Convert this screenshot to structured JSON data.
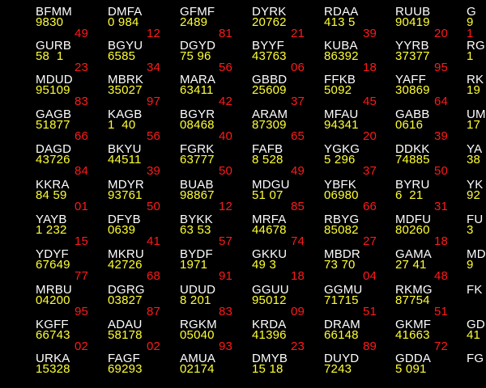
{
  "colors": {
    "background": "#000000",
    "symbol": "#ffffff",
    "value": "#ffff33",
    "change": "#ff1a1a"
  },
  "board": {
    "rows": [
      [
        {
          "symbol": "BFMM",
          "value": "9830",
          "change": "49"
        },
        {
          "symbol": "DMFA",
          "value": "0 984",
          "change": "12"
        },
        {
          "symbol": "GFMF",
          "value": "2489",
          "change": "81"
        },
        {
          "symbol": "DYRK",
          "value": "20762",
          "change": "21"
        },
        {
          "symbol": "RDAA",
          "value": "413 5",
          "change": "39"
        },
        {
          "symbol": "RUUB",
          "value": "90419",
          "change": "20"
        },
        {
          "symbol": "G",
          "value": "9",
          "change": "1"
        }
      ],
      [
        {
          "symbol": "GURB",
          "value": "58  1",
          "change": "23"
        },
        {
          "symbol": "BGYU",
          "value": "6585",
          "change": "34"
        },
        {
          "symbol": "DGYD",
          "value": "75 96",
          "change": "56"
        },
        {
          "symbol": "BYYF",
          "value": "43763",
          "change": "06"
        },
        {
          "symbol": "KUBA",
          "value": "86392",
          "change": "18"
        },
        {
          "symbol": "YYRB",
          "value": "37377",
          "change": "95"
        },
        {
          "symbol": "RG",
          "value": "1",
          "change": ""
        }
      ],
      [
        {
          "symbol": "MDUD",
          "value": "95109",
          "change": "83"
        },
        {
          "symbol": "MBRK",
          "value": "35027",
          "change": "97"
        },
        {
          "symbol": "MARA",
          "value": "63411",
          "change": "42"
        },
        {
          "symbol": "GBBD",
          "value": "25609",
          "change": "37"
        },
        {
          "symbol": "FFKB",
          "value": "5092",
          "change": "45"
        },
        {
          "symbol": "YAFF",
          "value": "30869",
          "change": "64"
        },
        {
          "symbol": "RK",
          "value": "19",
          "change": ""
        }
      ],
      [
        {
          "symbol": "GAGB",
          "value": "51877",
          "change": "66"
        },
        {
          "symbol": "KAGB",
          "value": "1  40",
          "change": "56"
        },
        {
          "symbol": "BGYR",
          "value": "08468",
          "change": "40"
        },
        {
          "symbol": "ARAM",
          "value": "87309",
          "change": "65"
        },
        {
          "symbol": "MFAU",
          "value": "94341",
          "change": "20"
        },
        {
          "symbol": "GABB",
          "value": "0616",
          "change": "39"
        },
        {
          "symbol": "UM",
          "value": "17",
          "change": ""
        }
      ],
      [
        {
          "symbol": "DAGD",
          "value": "43726",
          "change": "84"
        },
        {
          "symbol": "BKYU",
          "value": "44511",
          "change": "39"
        },
        {
          "symbol": "FGRK",
          "value": "63777",
          "change": "50"
        },
        {
          "symbol": "FAFB",
          "value": "8 528",
          "change": "49"
        },
        {
          "symbol": "YGKG",
          "value": "5 296",
          "change": "37"
        },
        {
          "symbol": "DDKK",
          "value": "74885",
          "change": "50"
        },
        {
          "symbol": "YA",
          "value": "38",
          "change": ""
        }
      ],
      [
        {
          "symbol": "KKRA",
          "value": "84 59",
          "change": "01"
        },
        {
          "symbol": "MDYR",
          "value": "93761",
          "change": "50"
        },
        {
          "symbol": "BUAB",
          "value": "98867",
          "change": "12"
        },
        {
          "symbol": "MDGU",
          "value": "51 07",
          "change": "85"
        },
        {
          "symbol": "YBFK",
          "value": "06980",
          "change": "66"
        },
        {
          "symbol": "BYRU",
          "value": "6  21",
          "change": "31"
        },
        {
          "symbol": "YK",
          "value": "92",
          "change": ""
        }
      ],
      [
        {
          "symbol": "YAYB",
          "value": "1 232",
          "change": "15"
        },
        {
          "symbol": "DFYB",
          "value": "0639",
          "change": "41"
        },
        {
          "symbol": "BYKK",
          "value": "63 53",
          "change": "57"
        },
        {
          "symbol": "MRFA",
          "value": "44678",
          "change": "74"
        },
        {
          "symbol": "RBYG",
          "value": "85082",
          "change": "27"
        },
        {
          "symbol": "MDFU",
          "value": "80260",
          "change": "18"
        },
        {
          "symbol": "FU",
          "value": "3",
          "change": ""
        }
      ],
      [
        {
          "symbol": "YDYF",
          "value": "67649",
          "change": "77"
        },
        {
          "symbol": "MKRU",
          "value": "42726",
          "change": "68"
        },
        {
          "symbol": "BYDF",
          "value": "1971",
          "change": "91"
        },
        {
          "symbol": "GKKU",
          "value": "49 3",
          "change": "18"
        },
        {
          "symbol": "MBDR",
          "value": "73 70",
          "change": "04"
        },
        {
          "symbol": "GAMA",
          "value": "27 41",
          "change": "48"
        },
        {
          "symbol": "MD",
          "value": "9",
          "change": ""
        }
      ],
      [
        {
          "symbol": "MRBU",
          "value": "04200",
          "change": "95"
        },
        {
          "symbol": "DGRG",
          "value": "03827",
          "change": "87"
        },
        {
          "symbol": "UDUD",
          "value": "8 201",
          "change": "83"
        },
        {
          "symbol": "GGUU",
          "value": "95012",
          "change": "09"
        },
        {
          "symbol": "GGMU",
          "value": "71715",
          "change": "51"
        },
        {
          "symbol": "RKMG",
          "value": "87754",
          "change": "51"
        },
        {
          "symbol": "FK",
          "value": "",
          "change": ""
        }
      ],
      [
        {
          "symbol": "KGFF",
          "value": "66743",
          "change": "02"
        },
        {
          "symbol": "ADAU",
          "value": "58178",
          "change": "02"
        },
        {
          "symbol": "RGKM",
          "value": "05040",
          "change": "93"
        },
        {
          "symbol": "KRDA",
          "value": "41396",
          "change": "23"
        },
        {
          "symbol": "DRAM",
          "value": "66148",
          "change": "89"
        },
        {
          "symbol": "GKMF",
          "value": "41663",
          "change": "72"
        },
        {
          "symbol": "GD",
          "value": "41",
          "change": ""
        }
      ],
      [
        {
          "symbol": "URKA",
          "value": "15328",
          "change": ""
        },
        {
          "symbol": "FAGF",
          "value": "69293",
          "change": ""
        },
        {
          "symbol": "AMUA",
          "value": "02174",
          "change": ""
        },
        {
          "symbol": "DMYB",
          "value": "15 18",
          "change": ""
        },
        {
          "symbol": "DUYD",
          "value": "7243",
          "change": ""
        },
        {
          "symbol": "GDDA",
          "value": "5 091",
          "change": ""
        },
        {
          "symbol": "FG",
          "value": "",
          "change": ""
        }
      ]
    ]
  }
}
